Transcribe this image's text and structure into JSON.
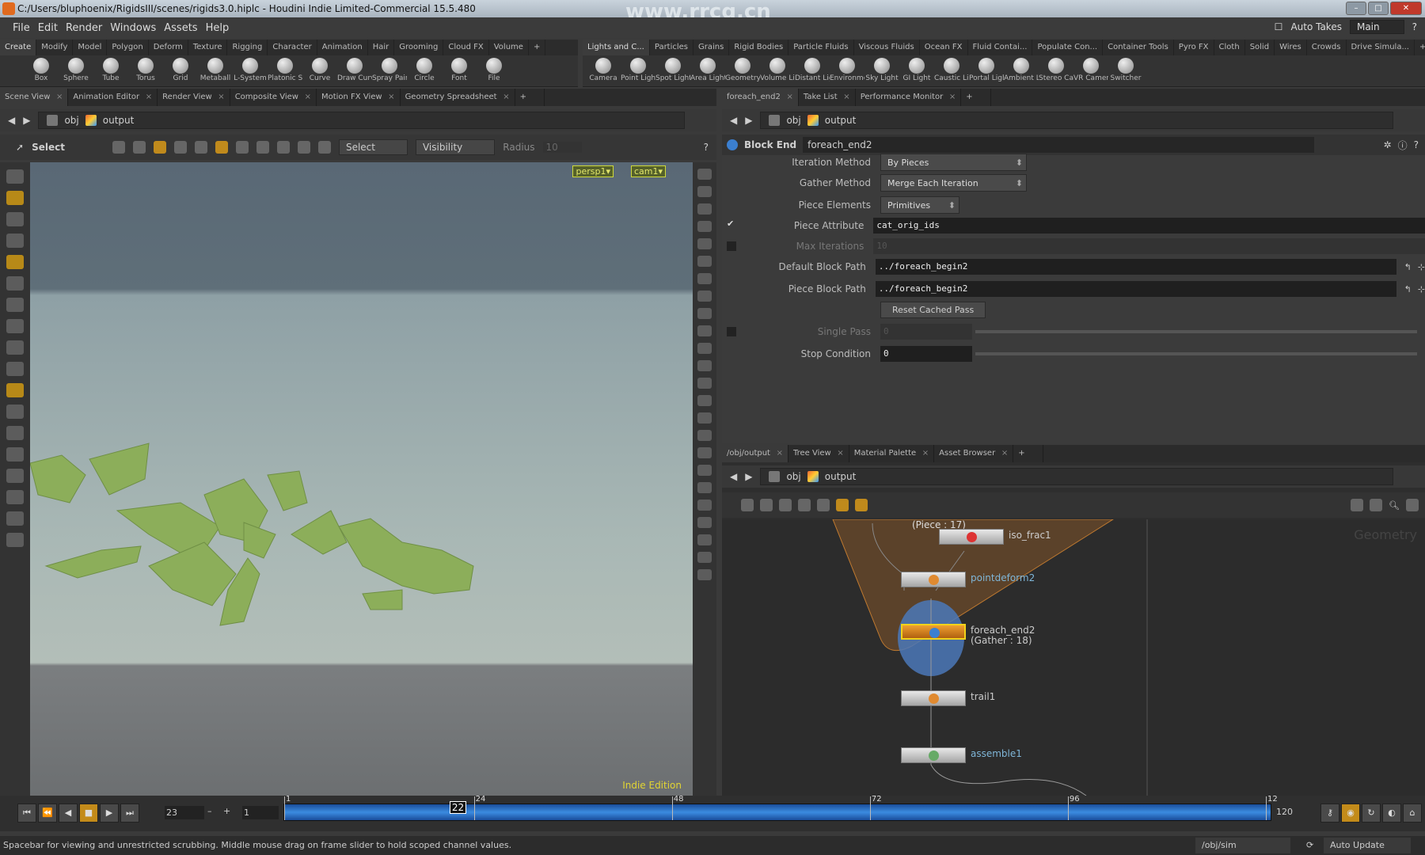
{
  "window": {
    "title": "C:/Users/bluphoenix/RigidsIII/scenes/rigids3.0.hiplc - Houdini Indie Limited-Commercial 15.5.480",
    "watermark": "www.rrcg.cn"
  },
  "menu": {
    "items": [
      "File",
      "Edit",
      "Render",
      "Windows",
      "Assets",
      "Help"
    ],
    "auto_takes": "Auto Takes",
    "desktop": "Main"
  },
  "shelf_left": {
    "tabs": [
      "Create",
      "Modify",
      "Model",
      "Polygon",
      "Deform",
      "Texture",
      "Rigging",
      "Character",
      "Animation",
      "Hair",
      "Grooming",
      "Cloud FX",
      "Volume"
    ],
    "tools": [
      "Box",
      "Sphere",
      "Tube",
      "Torus",
      "Grid",
      "Metaball",
      "L-System",
      "Platonic Sol...",
      "Curve",
      "Draw Curve",
      "Spray Paint",
      "Circle",
      "Font",
      "File"
    ]
  },
  "shelf_right": {
    "tabs": [
      "Lights and C...",
      "Particles",
      "Grains",
      "Rigid Bodies",
      "Particle Fluids",
      "Viscous Fluids",
      "Ocean FX",
      "Fluid Contai...",
      "Populate Con...",
      "Container Tools",
      "Pyro FX",
      "Cloth",
      "Solid",
      "Wires",
      "Crowds",
      "Drive Simula..."
    ],
    "tools": [
      "Camera",
      "Point Light",
      "Spot Light",
      "Area Light",
      "Geometry L...",
      "Volume Light",
      "Distant Light",
      "Environmen...",
      "Sky Light",
      "GI Light",
      "Caustic Light",
      "Portal Light",
      "Ambient Lig...",
      "Stereo Cam...",
      "VR Camera",
      "Switcher"
    ]
  },
  "left_pane": {
    "tabs": [
      "Scene View",
      "Animation Editor",
      "Render View",
      "Composite View",
      "Motion FX View",
      "Geometry Spreadsheet"
    ],
    "path": [
      "obj",
      "output"
    ]
  },
  "viewport": {
    "tool": "Select",
    "select_mode": "Select",
    "visibility": "Visibility",
    "radius_label": "Radius",
    "radius_value": "10",
    "camera": "persp1▾",
    "cam": "cam1▾",
    "edition": "Indie Edition"
  },
  "param_pane": {
    "tabs": [
      "foreach_end2",
      "Take List",
      "Performance Monitor"
    ],
    "path": [
      "obj",
      "output"
    ],
    "node_type": "Block End",
    "node_name": "foreach_end2",
    "params": [
      {
        "label": "Iteration Method",
        "type": "menu",
        "value": "By Pieces"
      },
      {
        "label": "Gather Method",
        "type": "menu",
        "value": "Merge Each Iteration"
      },
      {
        "label": "Piece Elements",
        "type": "menu",
        "value": "Primitives"
      },
      {
        "label": "Piece Attribute",
        "type": "field",
        "value": "cat_orig_ids",
        "checked": true
      },
      {
        "label": "Max Iterations",
        "type": "field",
        "value": "10",
        "disabled": true,
        "checked": false
      },
      {
        "label": "Default Block Path",
        "type": "field",
        "value": "../foreach_begin2"
      },
      {
        "label": "Piece Block Path",
        "type": "field",
        "value": "../foreach_begin2"
      },
      {
        "label": "",
        "type": "button",
        "value": "Reset Cached Pass"
      },
      {
        "label": "Single Pass",
        "type": "field",
        "value": "0",
        "disabled": true,
        "checked": false
      },
      {
        "label": "Stop Condition",
        "type": "field",
        "value": "0"
      }
    ]
  },
  "network_pane": {
    "tabs": [
      "/obj/output",
      "Tree View",
      "Material Palette",
      "Asset Browser"
    ],
    "path": [
      "obj",
      "output"
    ],
    "context_label": "Geometry",
    "nodes": [
      {
        "name": "iso_frac1",
        "label_color": "plain"
      },
      {
        "name": "pointdeform2",
        "label_color": "blue"
      },
      {
        "name": "foreach_end2",
        "sub": "(Gather : 18)",
        "label_color": "plain"
      },
      {
        "name": "trail1",
        "label_color": "plain"
      },
      {
        "name": "assemble1",
        "label_color": "blue"
      }
    ],
    "partial_label": "(Piece : 17)"
  },
  "timeline": {
    "current_frame": "23",
    "step": "1",
    "start": "1",
    "end": "120",
    "marker": "22",
    "ticks": [
      "1",
      "24",
      "48",
      "72",
      "96",
      "12"
    ],
    "range_end_label": "120"
  },
  "status": {
    "message": "Spacebar for viewing and unrestricted scrubbing. Middle mouse drag on frame slider to hold scoped channel values.",
    "context": "/obj/sim",
    "update_mode": "Auto Update"
  },
  "colors": {
    "accent": "#c38b1a",
    "timeline": "#3b8be0",
    "geometry": "#8cae5a"
  }
}
